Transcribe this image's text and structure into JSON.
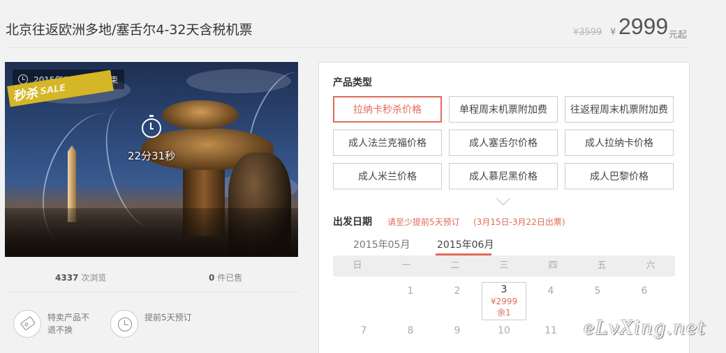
{
  "product": {
    "title": "北京往返欧洲多地/塞舌尔4-32天含税机票",
    "old_price": "¥3599",
    "currency_symbol": "¥",
    "price": "2999",
    "price_unit": "元起"
  },
  "photo": {
    "end_date_text": "2015年07月21日结束",
    "sale_badge_cn": "秒杀",
    "sale_badge_en": "SALE",
    "countdown": "22分31秒"
  },
  "stats": {
    "views_count": "4337",
    "views_label": "次浏览",
    "sold_count": "0",
    "sold_label": "件已售"
  },
  "features": [
    {
      "icon": "tag-icon",
      "text": "特卖产品不退不换"
    },
    {
      "icon": "clock-icon",
      "text": "提前5天预订"
    }
  ],
  "product_types": {
    "heading": "产品类型",
    "options": [
      {
        "label": "拉纳卡秒杀价格",
        "selected": true
      },
      {
        "label": "单程周末机票附加费",
        "selected": false
      },
      {
        "label": "往返程周末机票附加费",
        "selected": false
      },
      {
        "label": "成人法兰克福价格",
        "selected": false
      },
      {
        "label": "成人塞舌尔价格",
        "selected": false
      },
      {
        "label": "成人拉纳卡价格",
        "selected": false
      },
      {
        "label": "成人米兰价格",
        "selected": false
      },
      {
        "label": "成人慕尼黑价格",
        "selected": false
      },
      {
        "label": "成人巴黎价格",
        "selected": false
      }
    ]
  },
  "departure": {
    "heading": "出发日期",
    "advance_note": "请至少提前5天预订",
    "ticket_window": "(3月15日-3月22日出票)",
    "months": [
      {
        "label": "2015年05月",
        "active": false
      },
      {
        "label": "2015年06月",
        "active": true
      }
    ],
    "weekdays": [
      "日",
      "一",
      "二",
      "三",
      "四",
      "五",
      "六"
    ],
    "row1": [
      "",
      "1",
      "2",
      "3",
      "4",
      "5",
      "6"
    ],
    "row2": [
      "7",
      "8",
      "9",
      "10",
      "11",
      "",
      ""
    ],
    "available_day": {
      "day": "3",
      "price": "¥2999",
      "stock": "余1"
    }
  },
  "watermark": "eLvXing.net",
  "colors": {
    "accent": "#e06a5a",
    "badge": "#d4b626"
  }
}
